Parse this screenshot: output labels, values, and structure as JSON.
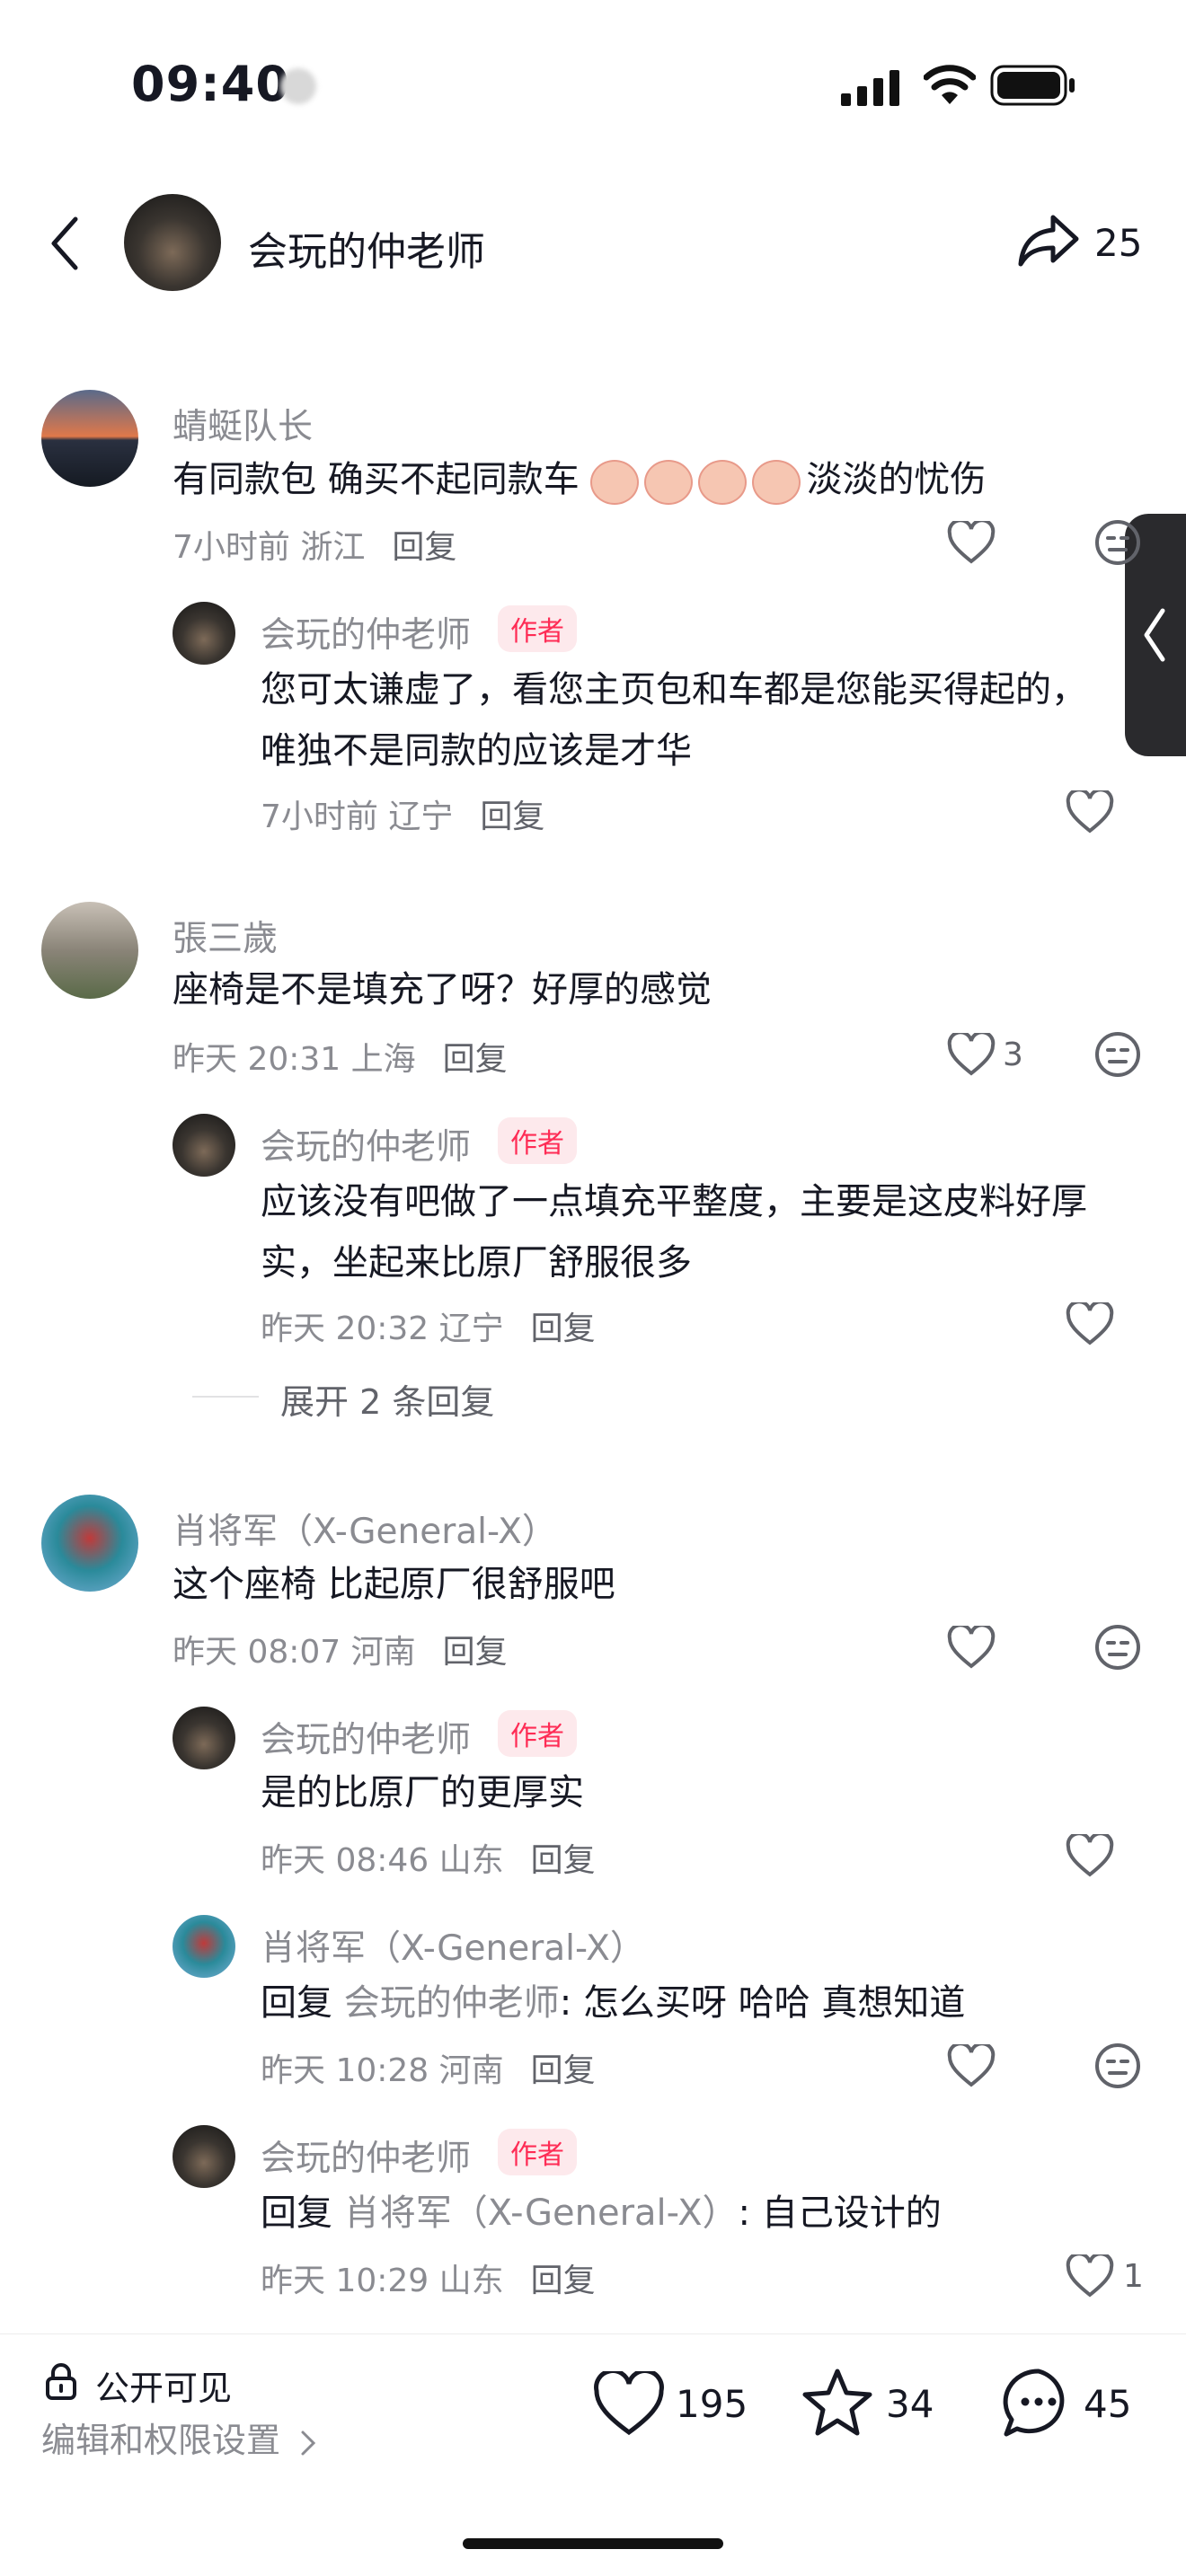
{
  "status": {
    "time": "09:40"
  },
  "header": {
    "title": "会玩的仲老师",
    "share_count": "25"
  },
  "comments": [
    {
      "user": "蜻蜓队长",
      "text": "有同款包 确买不起同款车",
      "text_suffix": "淡淡的忧伤",
      "time": "7小时前 浙江",
      "reply_label": "回复",
      "likes": "",
      "replies": [
        {
          "user": "会玩的仲老师",
          "badge": "作者",
          "text_lines": [
            "您可太谦虚了，看您主页包和车都是您能买得起的，",
            "唯独不是同款的应该是才华"
          ],
          "time": "7小时前 辽宁",
          "reply_label": "回复",
          "likes": ""
        }
      ]
    },
    {
      "user": "張三歲",
      "text": "座椅是不是填充了呀？好厚的感觉",
      "time": "昨天 20:31 上海",
      "reply_label": "回复",
      "likes": "3",
      "replies": [
        {
          "user": "会玩的仲老师",
          "badge": "作者",
          "text_lines": [
            "应该没有吧做了一点填充平整度，主要是这皮料好厚",
            "实，坐起来比原厂舒服很多"
          ],
          "time": "昨天 20:32 辽宁",
          "reply_label": "回复",
          "likes": ""
        }
      ],
      "expand_label": "展开 2 条回复"
    },
    {
      "user": "肖将军（X-General-X）",
      "text": "这个座椅 比起原厂很舒服吧",
      "time": "昨天 08:07 河南",
      "reply_label": "回复",
      "likes": "",
      "replies": [
        {
          "user": "会玩的仲老师",
          "badge": "作者",
          "text_lines": [
            "是的比原厂的更厚实"
          ],
          "time": "昨天 08:46 山东",
          "reply_label": "回复",
          "likes": ""
        },
        {
          "user": "肖将军（X-General-X）",
          "reply_prefix": "回复 ",
          "reply_to": "会玩的仲老师",
          "text_lines": [
            ": 怎么买呀 哈哈 真想知道"
          ],
          "time": "昨天 10:28 河南",
          "reply_label": "回复",
          "likes": ""
        },
        {
          "user": "会玩的仲老师",
          "badge": "作者",
          "reply_prefix": "回复 ",
          "reply_to": "肖将军（X-General-X）",
          "text_lines": [
            ": 自己设计的"
          ],
          "time": "昨天 10:29 山东",
          "reply_label": "回复",
          "likes": "1"
        }
      ]
    }
  ],
  "bottom": {
    "visibility": "公开可见",
    "settings_label": "编辑和权限设置",
    "like_count": "195",
    "fav_count": "34",
    "comment_count": "45"
  },
  "colors": {
    "accent": "#fe2c55",
    "text": "#161823",
    "muted": "#8a8b91"
  }
}
